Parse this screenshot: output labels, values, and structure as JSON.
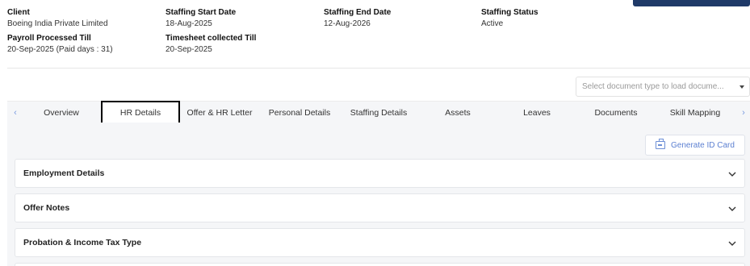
{
  "info": {
    "client_label": "Client",
    "client_value": "Boeing India Private Limited",
    "start_label": "Staffing Start Date",
    "start_value": "18-Aug-2025",
    "end_label": "Staffing End Date",
    "end_value": "12-Aug-2026",
    "status_label": "Staffing Status",
    "status_value": "Active",
    "payroll_label": "Payroll Processed Till",
    "payroll_value": "20-Sep-2025 (Paid days : 31)",
    "timesheet_label": "Timesheet collected Till",
    "timesheet_value": "20-Sep-2025"
  },
  "document_select": {
    "placeholder": "Select document type to load docume..."
  },
  "tabs": [
    {
      "label": "Overview"
    },
    {
      "label": "HR Details"
    },
    {
      "label": "Offer & HR Letter"
    },
    {
      "label": "Personal Details"
    },
    {
      "label": "Staffing Details"
    },
    {
      "label": "Assets"
    },
    {
      "label": "Leaves"
    },
    {
      "label": "Documents"
    },
    {
      "label": "Skill Mapping"
    }
  ],
  "active_tab": "HR Details",
  "tab_arrows": {
    "left": "‹",
    "right": "›"
  },
  "generate_button": {
    "label": "Generate ID Card",
    "icon": "id-card-icon"
  },
  "sections": [
    {
      "title": "Employment Details"
    },
    {
      "title": "Offer Notes"
    },
    {
      "title": "Probation & Income Tax Type"
    }
  ],
  "colors": {
    "accent": "#5b7fd1",
    "header_button": "#1f3a68",
    "tab_bar_bg": "#f5f6f8"
  }
}
